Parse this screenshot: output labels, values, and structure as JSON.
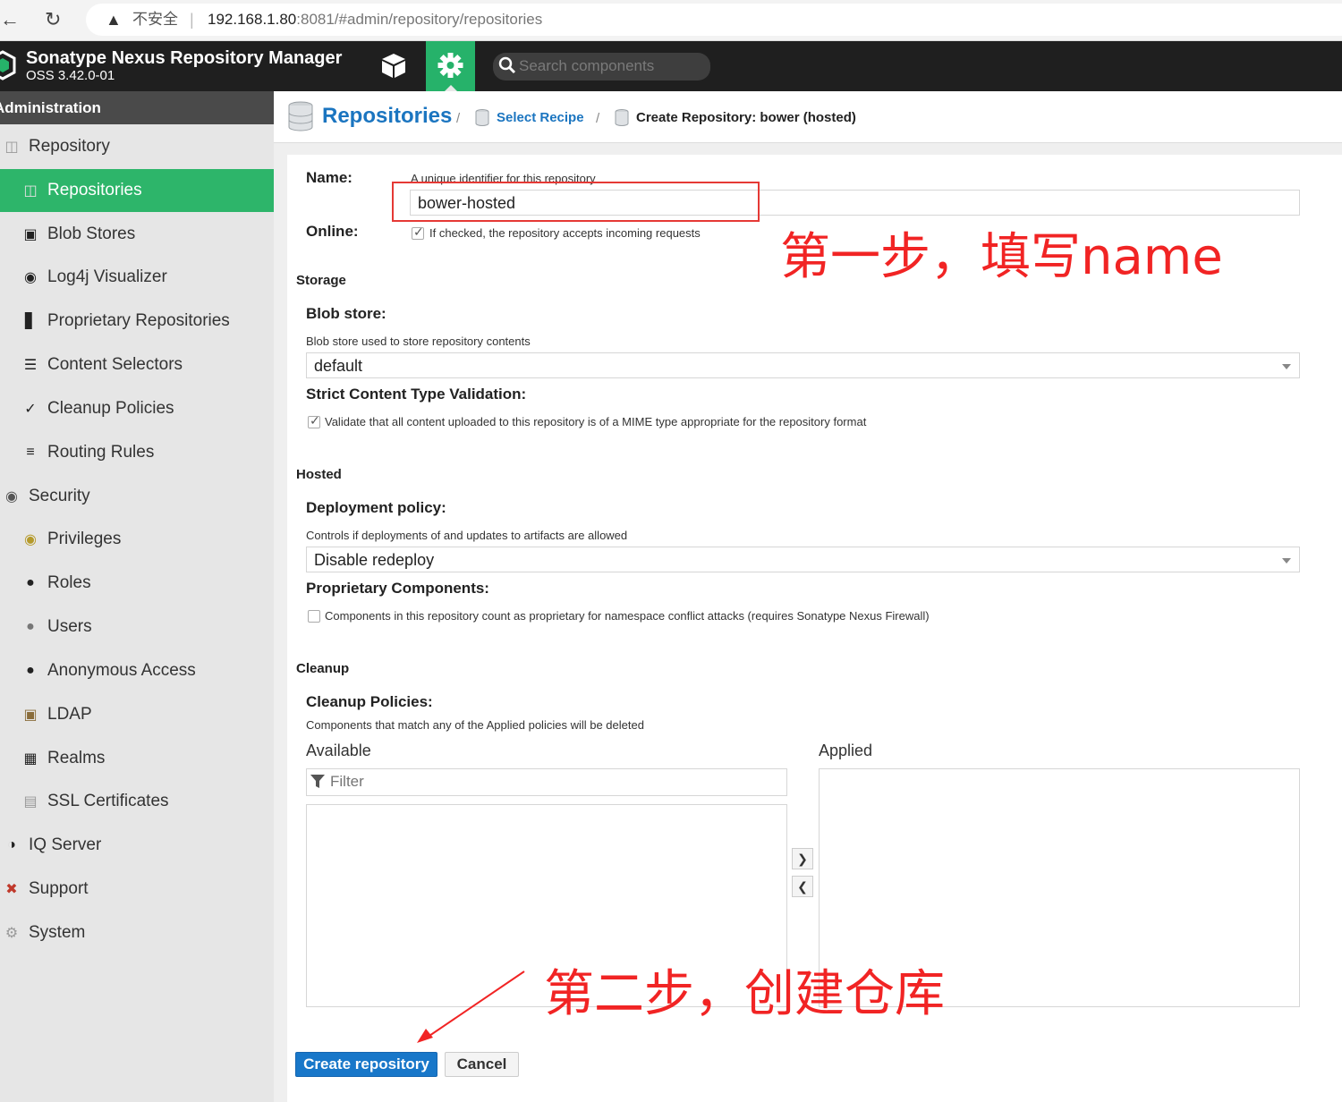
{
  "browser": {
    "warning": "▲",
    "insecure_label": "不安全",
    "separator": "|",
    "url_host": "192.168.1.80",
    "url_rest": ":8081/#admin/repository/repositories"
  },
  "header": {
    "title": "Sonatype Nexus Repository Manager",
    "version": "OSS 3.42.0-01",
    "search_placeholder": "Search components"
  },
  "sidebar": {
    "title": "Administration",
    "items": [
      {
        "label": "Repository",
        "icon": "database-icon",
        "level": 0
      },
      {
        "label": "Repositories",
        "icon": "database-icon",
        "level": 1,
        "active": true
      },
      {
        "label": "Blob Stores",
        "icon": "hdd-icon",
        "level": 1
      },
      {
        "label": "Log4j Visualizer",
        "icon": "binoculars-icon",
        "level": 1
      },
      {
        "label": "Proprietary Repositories",
        "icon": "door-icon",
        "level": 1
      },
      {
        "label": "Content Selectors",
        "icon": "layers-icon",
        "level": 1
      },
      {
        "label": "Cleanup Policies",
        "icon": "broom-icon",
        "level": 1
      },
      {
        "label": "Routing Rules",
        "icon": "signpost-icon",
        "level": 1
      },
      {
        "label": "Security",
        "icon": "eye-icon",
        "level": 0
      },
      {
        "label": "Privileges",
        "icon": "badge-icon",
        "level": 1
      },
      {
        "label": "Roles",
        "icon": "user-gear-icon",
        "level": 1
      },
      {
        "label": "Users",
        "icon": "users-icon",
        "level": 1
      },
      {
        "label": "Anonymous Access",
        "icon": "user-icon",
        "level": 1
      },
      {
        "label": "LDAP",
        "icon": "book-icon",
        "level": 1
      },
      {
        "label": "Realms",
        "icon": "building-icon",
        "level": 1
      },
      {
        "label": "SSL Certificates",
        "icon": "certificate-icon",
        "level": 1
      },
      {
        "label": "IQ Server",
        "icon": "shield-icon",
        "level": 0
      },
      {
        "label": "Support",
        "icon": "lifebuoy-icon",
        "level": 0
      },
      {
        "label": "System",
        "icon": "gear-icon",
        "level": 0
      }
    ]
  },
  "breadcrumb": {
    "title": "Repositories",
    "sep": "/",
    "recipe": "Select Recipe",
    "current": "Create Repository: bower (hosted)"
  },
  "form": {
    "name_label": "Name:",
    "name_help": "A unique identifier for this repository",
    "name_value": "bower-hosted",
    "online_label": "Online:",
    "online_help": "If checked, the repository accepts incoming requests",
    "storage_section": "Storage",
    "blob_label": "Blob store:",
    "blob_help": "Blob store used to store repository contents",
    "blob_value": "default",
    "strict_label": "Strict Content Type Validation:",
    "strict_help": "Validate that all content uploaded to this repository is of a MIME type appropriate for the repository format",
    "hosted_section": "Hosted",
    "deploy_label": "Deployment policy:",
    "deploy_help": "Controls if deployments of and updates to artifacts are allowed",
    "deploy_value": "Disable redeploy",
    "proprietary_label": "Proprietary Components:",
    "proprietary_help": "Components in this repository count as proprietary for namespace conflict attacks (requires Sonatype Nexus Firewall)",
    "cleanup_section": "Cleanup",
    "cleanup_label": "Cleanup Policies:",
    "cleanup_help": "Components that match any of the Applied policies will be deleted",
    "available_label": "Available",
    "applied_label": "Applied",
    "filter_placeholder": "Filter",
    "create_button": "Create repository",
    "cancel_button": "Cancel"
  },
  "annotations": {
    "step1": "第一步，填写name",
    "step2": "第二步，创建仓库"
  },
  "colors": {
    "accent_green": "#2db56a",
    "link_blue": "#1b75c0",
    "primary_button": "#1877c9",
    "annotation_red": "#f12424"
  }
}
